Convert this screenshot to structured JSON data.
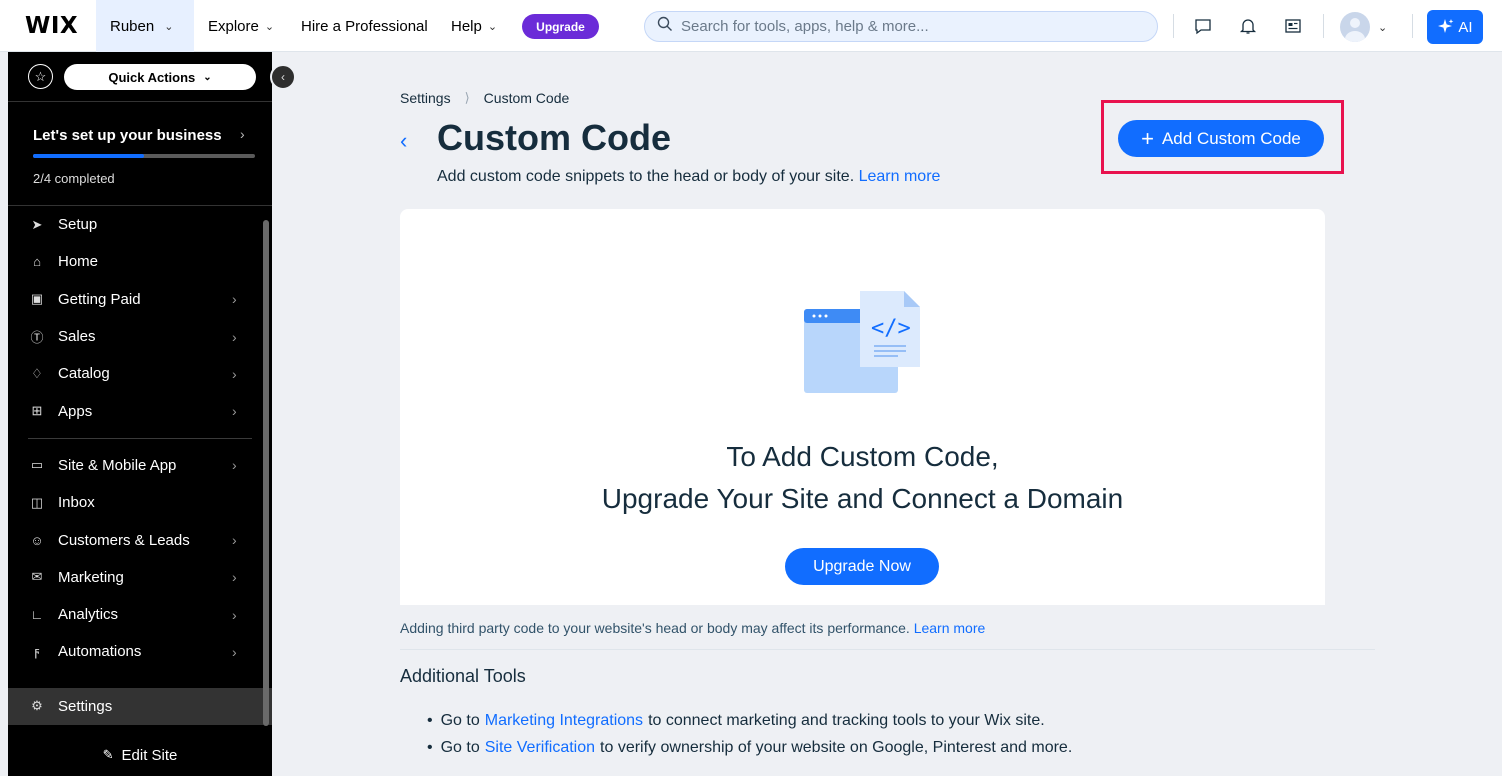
{
  "topbar": {
    "logo": "WIX",
    "site_name": "Ruben",
    "nav": [
      {
        "label": "Explore"
      },
      {
        "label": "Hire a Professional"
      },
      {
        "label": "Help"
      }
    ],
    "upgrade_label": "Upgrade",
    "search_placeholder": "Search for tools, apps, help & more...",
    "ai_label": "AI"
  },
  "sidebar": {
    "quick_actions_label": "Quick Actions",
    "setup_title": "Let's set up your business",
    "setup_progress": 0.5,
    "setup_count": "2/4 completed",
    "items": [
      {
        "label": "Setup",
        "icon": "rocket-icon"
      },
      {
        "label": "Home",
        "icon": "home-icon"
      },
      {
        "label": "Getting Paid",
        "icon": "payment-icon"
      },
      {
        "label": "Sales",
        "icon": "dollar-icon"
      },
      {
        "label": "Catalog",
        "icon": "catalog-icon"
      },
      {
        "label": "Apps",
        "icon": "apps-icon"
      },
      {
        "label": "Site & Mobile App",
        "icon": "device-icon"
      },
      {
        "label": "Inbox",
        "icon": "inbox-icon"
      },
      {
        "label": "Customers & Leads",
        "icon": "people-icon"
      },
      {
        "label": "Marketing",
        "icon": "megaphone-icon"
      },
      {
        "label": "Analytics",
        "icon": "chart-icon"
      },
      {
        "label": "Automations",
        "icon": "lightning-icon"
      },
      {
        "label": "Settings",
        "icon": "gear-icon"
      }
    ],
    "edit_site_label": "Edit Site"
  },
  "main": {
    "breadcrumb": [
      "Settings",
      "Custom Code"
    ],
    "title": "Custom Code",
    "subtitle": "Add custom code snippets to the head or body of your site.",
    "learn_more": "Learn more",
    "add_button": "Add Custom Code",
    "card_title_line1": "To Add Custom Code,",
    "card_title_line2": "Upgrade Your Site and Connect a Domain",
    "upgrade_now": "Upgrade Now",
    "notice": "Adding third party code to your website's head or body may affect its performance.",
    "notice_link": "Learn more",
    "tools_title": "Additional Tools",
    "tools": [
      {
        "prefix": "Go to",
        "link": "Marketing Integrations",
        "suffix": "to connect marketing and tracking tools to your Wix site."
      },
      {
        "prefix": "Go to",
        "link": "Site Verification",
        "suffix": "to verify ownership of your website on Google, Pinterest and more."
      }
    ]
  },
  "colors": {
    "accent": "#116dff",
    "upgrade_purple": "#6b2bd8",
    "highlight_red": "#e8124e",
    "sidebar_bg": "#000000",
    "page_bg": "#eef0f4"
  }
}
